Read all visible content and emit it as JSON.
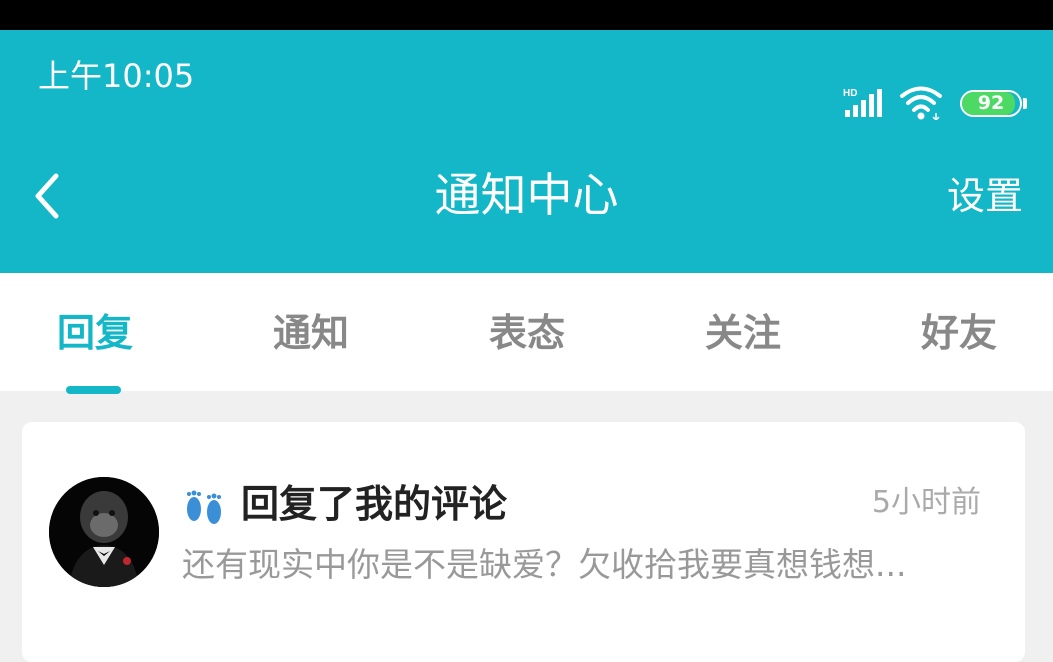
{
  "status_bar": {
    "time": "上午10:05",
    "network_label": "HD",
    "battery_level": "92",
    "icons": [
      "signal-icon",
      "wifi-icon",
      "battery-icon"
    ]
  },
  "header": {
    "title": "通知中心",
    "settings_label": "设置",
    "back_icon": "chevron-left-icon",
    "background_color": "#13b7c7"
  },
  "tabs": [
    {
      "label": "回复",
      "active": true
    },
    {
      "label": "通知",
      "active": false
    },
    {
      "label": "表态",
      "active": false
    },
    {
      "label": "关注",
      "active": false
    },
    {
      "label": "好友",
      "active": false
    }
  ],
  "notifications": [
    {
      "emoji": "👣",
      "title": "回复了我的评论",
      "time": "5小时前",
      "snippet": "还有现实中你是不是缺爱？欠收拾我要真想钱想..."
    }
  ],
  "colors": {
    "accent": "#13b7c7",
    "tab_inactive": "#888888",
    "time_text": "#aaaaaa"
  }
}
